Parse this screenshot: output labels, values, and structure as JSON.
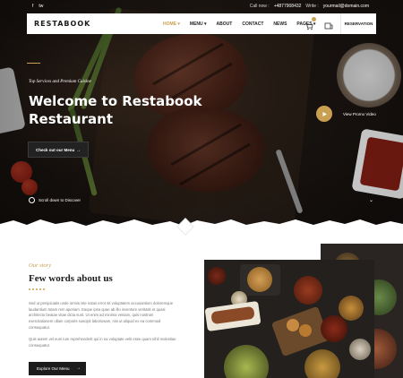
{
  "topbar": {
    "social": [
      "f",
      "tw"
    ],
    "call_label": "Call now :",
    "phone": "+4877908432",
    "write_label": "Write :",
    "email": "yourmail@domain.com"
  },
  "nav": {
    "logo": "RESTABOOK",
    "menu": [
      {
        "label": "HOME",
        "active": true,
        "has_dropdown": true
      },
      {
        "label": "MENU",
        "active": false,
        "has_dropdown": true
      },
      {
        "label": "ABOUT",
        "active": false,
        "has_dropdown": false
      },
      {
        "label": "CONTACT",
        "active": false,
        "has_dropdown": false
      },
      {
        "label": "NEWS",
        "active": false,
        "has_dropdown": false
      },
      {
        "label": "PAGES",
        "active": false,
        "has_dropdown": true
      }
    ],
    "icons": [
      "cart-icon",
      "user-icon"
    ],
    "reservation": "RESERVATION"
  },
  "hero": {
    "subtitle": "Top Services and Premium Cuisine",
    "title_line1": "Welcome to Restabook",
    "title_line2": "Restaurant",
    "button": "Check out our Menu",
    "video_label": "View Promo Video",
    "scroll_label": "Scroll down to Discover"
  },
  "about": {
    "eyebrow": "Our story",
    "title": "Few words about us",
    "paragraph1": "Sed ut perspiciatis unde omnis iste natus error sit voluptatem accusantium doloremque laudantium totam rem aperiam. Eaque ipsa quae ab illo inventore veritatis et quasi architecto beatae vitae dicta sunt. Ut enim ad minima veniam, quis nostrum exercitationem ullam corporis suscipit laboriosam, nisi ut aliquid ex ea commodi consequatur.",
    "paragraph2": "Quis autem vel eum iure reprehenderit qui in ea voluptate velit esse quam nihil molestiae consequatur.",
    "button": "Explore Our Menu"
  },
  "colors": {
    "accent": "#c9a052",
    "dark": "#1c1c1c",
    "text_muted": "#777777"
  }
}
